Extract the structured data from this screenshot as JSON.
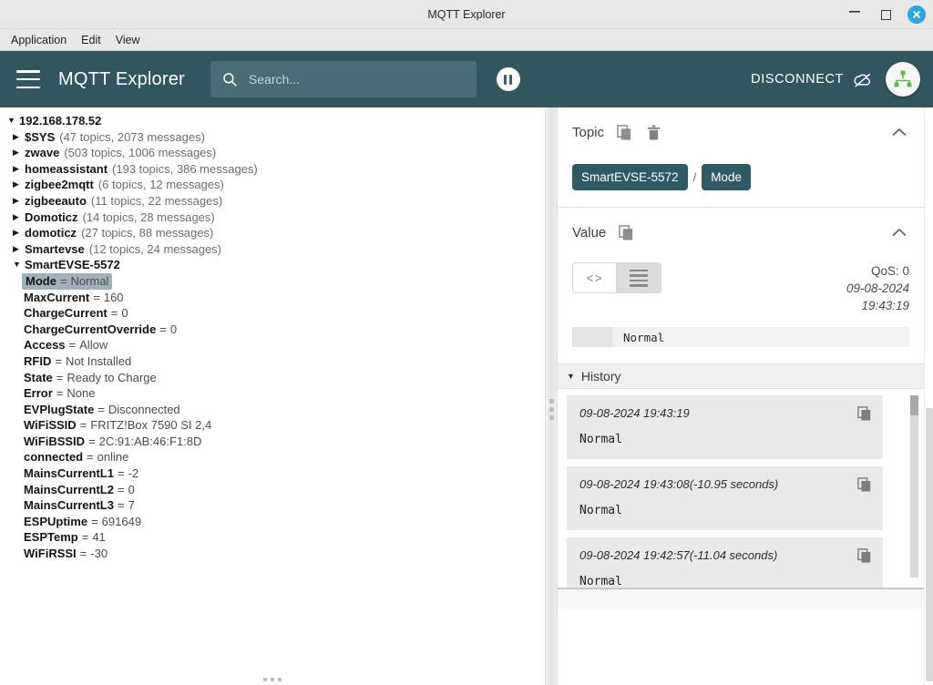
{
  "window": {
    "title": "MQTT Explorer",
    "minimize_label": "—",
    "maximize_label": "",
    "close_label": "×"
  },
  "menubar": {
    "items": [
      {
        "label": "Application"
      },
      {
        "label": "Edit"
      },
      {
        "label": "View"
      }
    ]
  },
  "toolbar": {
    "app_title": "MQTT Explorer",
    "menu_icon": "hamburger-icon",
    "search": {
      "placeholder": "Search...",
      "value": "",
      "icon": "search-icon"
    },
    "pause_icon": "pause-icon",
    "disconnect_label": "DISCONNECT",
    "disconnect_icon": "cloud-off-icon",
    "avatar_icon": "sitemap-icon",
    "accent_color": "#31565e"
  },
  "tree": {
    "root": {
      "label": "192.168.178.52",
      "expanded": true
    },
    "brokers": [
      {
        "label": "$SYS",
        "meta": "(47 topics, 2073 messages)",
        "expanded": false
      },
      {
        "label": "zwave",
        "meta": "(503 topics, 1006 messages)",
        "expanded": false
      },
      {
        "label": "homeassistant",
        "meta": "(193 topics, 386 messages)",
        "expanded": false
      },
      {
        "label": "zigbee2mqtt",
        "meta": "(6 topics, 12 messages)",
        "expanded": false
      },
      {
        "label": "zigbeeauto",
        "meta": "(11 topics, 22 messages)",
        "expanded": false
      },
      {
        "label": "Domoticz",
        "meta": "(14 topics, 28 messages)",
        "expanded": false
      },
      {
        "label": "domoticz",
        "meta": "(27 topics, 88 messages)",
        "expanded": false
      },
      {
        "label": "Smartevse",
        "meta": "(12 topics, 24 messages)",
        "expanded": false
      },
      {
        "label": "SmartEVSE-5572",
        "meta": "",
        "expanded": true
      }
    ],
    "leaves": [
      {
        "name": "Mode",
        "value": "Normal",
        "selected": true
      },
      {
        "name": "MaxCurrent",
        "value": "160",
        "selected": false
      },
      {
        "name": "ChargeCurrent",
        "value": "0",
        "selected": false
      },
      {
        "name": "ChargeCurrentOverride",
        "value": "0",
        "selected": false
      },
      {
        "name": "Access",
        "value": "Allow",
        "selected": false
      },
      {
        "name": "RFID",
        "value": "Not Installed",
        "selected": false
      },
      {
        "name": "State",
        "value": "Ready to Charge",
        "selected": false
      },
      {
        "name": "Error",
        "value": "None",
        "selected": false
      },
      {
        "name": "EVPlugState",
        "value": "Disconnected",
        "selected": false
      },
      {
        "name": "WiFiSSID",
        "value": "FRITZ!Box 7590 SI 2,4",
        "selected": false
      },
      {
        "name": "WiFiBSSID",
        "value": "2C:91:AB:46:F1:8D",
        "selected": false
      },
      {
        "name": "connected",
        "value": "online",
        "selected": false
      },
      {
        "name": "MainsCurrentL1",
        "value": "-2",
        "selected": false
      },
      {
        "name": "MainsCurrentL2",
        "value": "0",
        "selected": false
      },
      {
        "name": "MainsCurrentL3",
        "value": "7",
        "selected": false
      },
      {
        "name": "ESPUptime",
        "value": "691649",
        "selected": false
      },
      {
        "name": "ESPTemp",
        "value": "41",
        "selected": false
      },
      {
        "name": "WiFiRSSI",
        "value": "-30",
        "selected": false
      }
    ],
    "equals": "="
  },
  "detail": {
    "topic_section": {
      "title": "Topic",
      "copy_icon": "copy-icon",
      "delete_icon": "trash-icon",
      "collapse_icon": "chevron-up-icon",
      "chips": [
        "SmartEVSE-5572",
        "Mode"
      ],
      "separator": "/"
    },
    "value_section": {
      "title": "Value",
      "copy_icon": "copy-icon",
      "collapse_icon": "chevron-up-icon",
      "raw_view_label": "<>",
      "formatted_view_icon": "list-lines-icon",
      "active_view": "formatted",
      "qos": "QoS: 0",
      "date": "09-08-2024",
      "time": "19:43:19",
      "value": "Normal"
    },
    "history_section": {
      "title": "History",
      "caret": "▼",
      "copy_icon": "copy-icon",
      "entries": [
        {
          "timestamp": "09-08-2024 19:43:19",
          "value": "Normal"
        },
        {
          "timestamp": "09-08-2024 19:43:08(-10.95 seconds)",
          "value": "Normal"
        },
        {
          "timestamp": "09-08-2024 19:42:57(-11.04 seconds)",
          "value": "Normal"
        }
      ]
    }
  }
}
